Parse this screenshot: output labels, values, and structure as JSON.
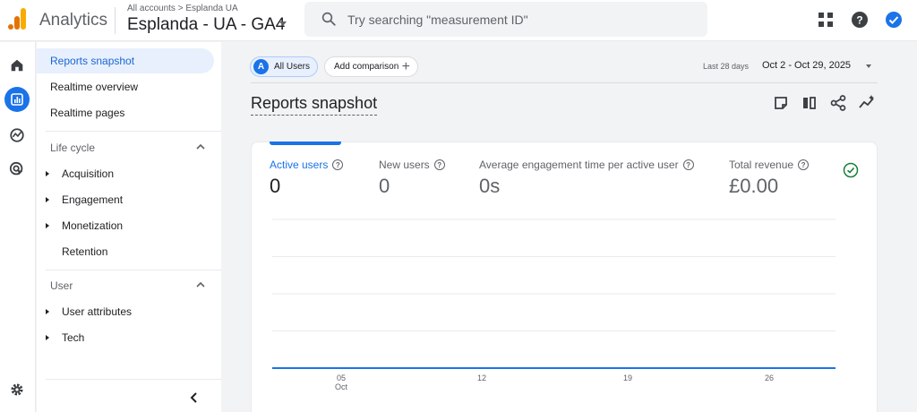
{
  "header": {
    "brand": "Analytics",
    "breadcrumb": "All accounts > Esplanda UA",
    "property": "Esplanda - UA - GA4",
    "search_placeholder": "Try searching \"measurement ID\""
  },
  "nav": {
    "items": [
      {
        "label": "Reports snapshot",
        "active": true
      },
      {
        "label": "Realtime overview"
      },
      {
        "label": "Realtime pages"
      }
    ],
    "sections": [
      {
        "title": "Life cycle",
        "items": [
          "Acquisition",
          "Engagement",
          "Monetization",
          "Retention"
        ]
      },
      {
        "title": "User",
        "items": [
          "User attributes",
          "Tech"
        ]
      }
    ]
  },
  "toolbar": {
    "segment_avatar": "A",
    "segment_label": "All Users",
    "add_comparison": "Add comparison",
    "date_label": "Last 28 days",
    "date_range": "Oct 2 - Oct 29, 2025"
  },
  "page_title": "Reports snapshot",
  "metrics": [
    {
      "label": "Active users",
      "value": "0"
    },
    {
      "label": "New users",
      "value": "0"
    },
    {
      "label": "Average engagement time per active user",
      "value": "0s"
    },
    {
      "label": "Total revenue",
      "value": "£0.00"
    }
  ],
  "chart_data": {
    "type": "line",
    "categories": [
      "05 Oct",
      "12",
      "19",
      "26"
    ],
    "x_ticks": [
      "05",
      "12",
      "19",
      "26"
    ],
    "x_tick_sub": "Oct",
    "series": [
      {
        "values": [
          0,
          0,
          0,
          0
        ]
      }
    ],
    "grid": true,
    "accent": "#1a73e8"
  },
  "colors": {
    "accent": "#1a73e8",
    "logo_orange": "#f9ab00",
    "logo_dark": "#e37400"
  }
}
